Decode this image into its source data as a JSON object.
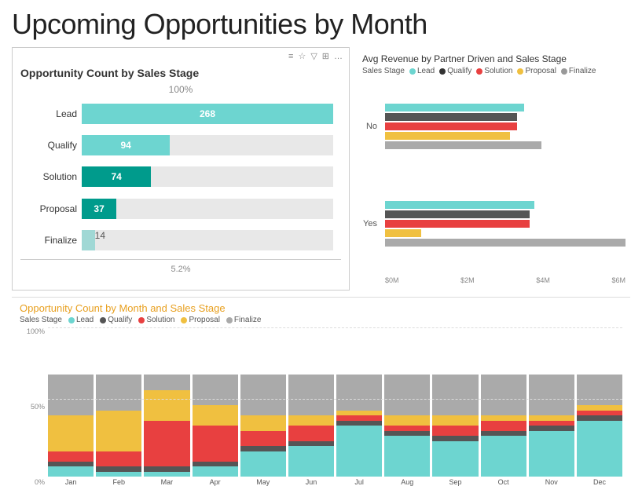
{
  "title": "Upcoming Opportunities by Month",
  "left_chart": {
    "title": "Opportunity Count by Sales Stage",
    "top_pct": "100%",
    "bottom_pct": "5.2%",
    "bars": [
      {
        "label": "Lead",
        "value": 268,
        "pct": 1.0,
        "color": "#6dd5d0",
        "show_value": true
      },
      {
        "label": "Qualify",
        "value": 94,
        "pct": 0.35,
        "color": "#6dd5d0",
        "show_value": true
      },
      {
        "label": "Solution",
        "value": 74,
        "pct": 0.277,
        "color": "#009b8c",
        "show_value": true
      },
      {
        "label": "Proposal",
        "value": 37,
        "pct": 0.138,
        "color": "#009b8c",
        "show_value": true
      },
      {
        "label": "Finalize",
        "value": 14,
        "pct": 0.052,
        "color": "#a0d8d5",
        "show_value": false
      }
    ]
  },
  "right_chart": {
    "title": "Avg Revenue by Partner Driven and Sales Stage",
    "legend_label": "Sales Stage",
    "legend_items": [
      {
        "label": "Lead",
        "color": "#6dd5d0"
      },
      {
        "label": "Qualify",
        "color": "#333333"
      },
      {
        "label": "Solution",
        "color": "#e84040"
      },
      {
        "label": "Proposal",
        "color": "#f0c040"
      },
      {
        "label": "Finalize",
        "color": "#999999"
      }
    ],
    "groups": [
      {
        "label": "No",
        "bars": [
          {
            "value": 0.58,
            "color": "#6dd5d0"
          },
          {
            "value": 0.55,
            "color": "#555555"
          },
          {
            "value": 0.55,
            "color": "#e84040"
          },
          {
            "value": 0.52,
            "color": "#f0c040"
          },
          {
            "value": 0.65,
            "color": "#aaaaaa"
          }
        ]
      },
      {
        "label": "Yes",
        "bars": [
          {
            "value": 0.62,
            "color": "#6dd5d0"
          },
          {
            "value": 0.6,
            "color": "#555555"
          },
          {
            "value": 0.6,
            "color": "#e84040"
          },
          {
            "value": 0.15,
            "color": "#f0c040"
          },
          {
            "value": 1.0,
            "color": "#aaaaaa"
          }
        ]
      }
    ],
    "x_labels": [
      "$0M",
      "$2M",
      "$4M",
      "$6M"
    ]
  },
  "bottom_chart": {
    "title": "Opportunity Count by Month and Sales Stage",
    "legend_label": "Sales Stage",
    "legend_items": [
      {
        "label": "Lead",
        "color": "#6dd5d0"
      },
      {
        "label": "Qualify",
        "color": "#555555"
      },
      {
        "label": "Solution",
        "color": "#e84040"
      },
      {
        "label": "Proposal",
        "color": "#f0c040"
      },
      {
        "label": "Finalize",
        "color": "#aaaaaa"
      }
    ],
    "y_labels": [
      "100%",
      "50%",
      "0%"
    ],
    "months": [
      "Jan",
      "Feb",
      "Mar",
      "Apr",
      "May",
      "Jun",
      "Jul",
      "Aug",
      "Sep",
      "Oct",
      "Nov",
      "Dec"
    ],
    "data": [
      {
        "month": "Jan",
        "lead": 0.1,
        "qualify": 0.05,
        "solution": 0.1,
        "proposal": 0.35,
        "finalize": 0.4
      },
      {
        "month": "Feb",
        "lead": 0.05,
        "qualify": 0.05,
        "solution": 0.15,
        "proposal": 0.4,
        "finalize": 0.35
      },
      {
        "month": "Mar",
        "lead": 0.05,
        "qualify": 0.05,
        "solution": 0.45,
        "proposal": 0.3,
        "finalize": 0.15
      },
      {
        "month": "Apr",
        "lead": 0.1,
        "qualify": 0.05,
        "solution": 0.35,
        "proposal": 0.2,
        "finalize": 0.3
      },
      {
        "month": "May",
        "lead": 0.25,
        "qualify": 0.05,
        "solution": 0.15,
        "proposal": 0.15,
        "finalize": 0.4
      },
      {
        "month": "Jun",
        "lead": 0.3,
        "qualify": 0.05,
        "solution": 0.15,
        "proposal": 0.1,
        "finalize": 0.4
      },
      {
        "month": "Jul",
        "lead": 0.5,
        "qualify": 0.05,
        "solution": 0.05,
        "proposal": 0.05,
        "finalize": 0.35
      },
      {
        "month": "Aug",
        "lead": 0.4,
        "qualify": 0.05,
        "solution": 0.05,
        "proposal": 0.1,
        "finalize": 0.4
      },
      {
        "month": "Sep",
        "lead": 0.35,
        "qualify": 0.05,
        "solution": 0.1,
        "proposal": 0.1,
        "finalize": 0.4
      },
      {
        "month": "Oct",
        "lead": 0.4,
        "qualify": 0.05,
        "solution": 0.1,
        "proposal": 0.05,
        "finalize": 0.4
      },
      {
        "month": "Nov",
        "lead": 0.45,
        "qualify": 0.05,
        "solution": 0.05,
        "proposal": 0.05,
        "finalize": 0.4
      },
      {
        "month": "Dec",
        "lead": 0.55,
        "qualify": 0.05,
        "solution": 0.05,
        "proposal": 0.05,
        "finalize": 0.3
      }
    ]
  },
  "toolbar": {
    "icons": [
      "≡",
      "☆",
      "▽",
      "⊞",
      "…"
    ]
  }
}
